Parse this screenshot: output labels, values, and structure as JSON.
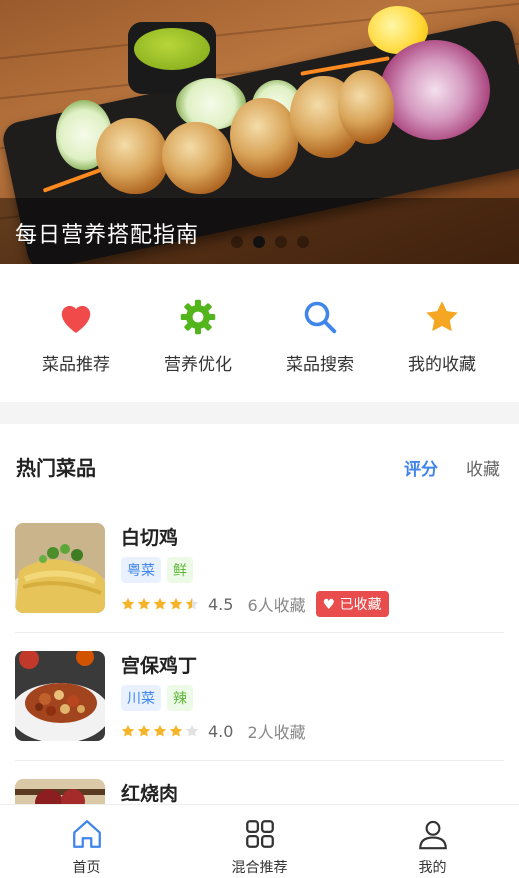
{
  "banner": {
    "title": "每日营养搭配指南",
    "slides": 4,
    "active_slide": 2
  },
  "quick_menu": [
    {
      "label": "菜品推荐",
      "icon": "heart-icon",
      "color": "#f04a4a"
    },
    {
      "label": "营养优化",
      "icon": "gear-icon",
      "color": "#52b51c"
    },
    {
      "label": "菜品搜索",
      "icon": "search-icon",
      "color": "#3f85ea"
    },
    {
      "label": "我的收藏",
      "icon": "star-icon",
      "color": "#f5a623"
    }
  ],
  "section": {
    "title": "热门菜品",
    "sort_tabs": [
      {
        "label": "评分",
        "active": true
      },
      {
        "label": "收藏",
        "active": false
      }
    ]
  },
  "dishes": [
    {
      "name": "白切鸡",
      "cuisine": "粤菜",
      "taste": "鲜",
      "rating": 4.5,
      "score": "4.5",
      "fav_text": "6人收藏",
      "favorited": true,
      "fav_badge": "♥ 已收藏"
    },
    {
      "name": "宫保鸡丁",
      "cuisine": "川菜",
      "taste": "辣",
      "rating": 4.0,
      "score": "4.0",
      "fav_text": "2人收藏",
      "favorited": false
    },
    {
      "name": "红烧肉"
    }
  ],
  "bottom_nav": [
    {
      "label": "首页",
      "icon": "home-icon",
      "active": true
    },
    {
      "label": "混合推荐",
      "icon": "grid-icon",
      "active": false
    },
    {
      "label": "我的",
      "icon": "user-icon",
      "active": false
    }
  ],
  "colors": {
    "accent": "#3f85ea",
    "favorite": "#e84c4c",
    "star": "#f5b52a"
  }
}
